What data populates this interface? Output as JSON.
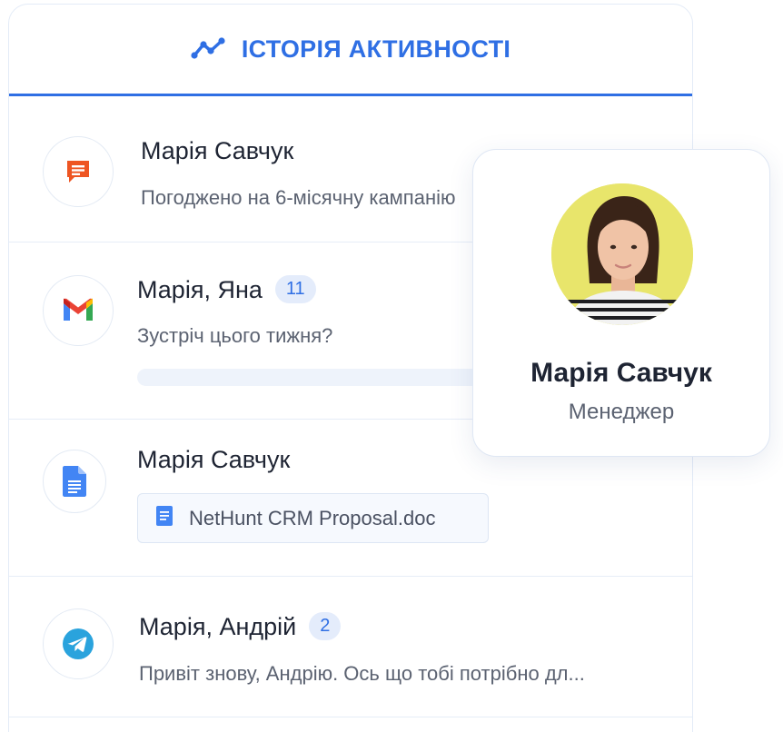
{
  "header": {
    "title": "ІСТОРІЯ АКТИВНОСТІ",
    "icon": "activity-trend-icon"
  },
  "activities": [
    {
      "icon": "comment-icon",
      "name": "Марія Савчук",
      "text": "Погоджено на 6-місячну кампанію"
    },
    {
      "icon": "gmail-icon",
      "name": "Марія, Яна",
      "count": "11",
      "text": "Зустріч цього тижня?",
      "progress": 0.0
    },
    {
      "icon": "google-docs-icon",
      "name": "Марія Савчук",
      "attachment": "NetHunt CRM Proposal.doc"
    },
    {
      "icon": "telegram-icon",
      "name": "Марія, Андрій",
      "count": "2",
      "text": "Привіт знову, Андрію. Ось що тобі потрібно дл..."
    }
  ],
  "profile": {
    "name": "Марія Савчук",
    "role": "Менеджер"
  },
  "colors": {
    "accent": "#2f6fe4",
    "badge_bg": "#e4ecfb",
    "avatar_bg": "#e8e56b"
  }
}
